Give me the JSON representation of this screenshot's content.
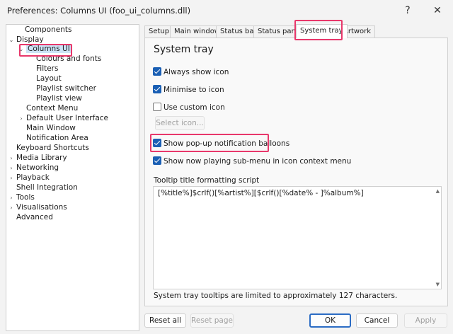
{
  "window": {
    "title": "Preferences: Columns UI (foo_ui_columns.dll)",
    "help_label": "?",
    "close_label": "✕"
  },
  "tree": {
    "items": [
      {
        "label": "Components",
        "expander": ""
      },
      {
        "label": "Display",
        "expander": "⌄"
      },
      {
        "label": "Columns UI",
        "expander": "⌄"
      },
      {
        "label": "Colours and fonts",
        "expander": ""
      },
      {
        "label": "Filters",
        "expander": ""
      },
      {
        "label": "Layout",
        "expander": ""
      },
      {
        "label": "Playlist switcher",
        "expander": ""
      },
      {
        "label": "Playlist view",
        "expander": ""
      },
      {
        "label": "Context Menu",
        "expander": ""
      },
      {
        "label": "Default User Interface",
        "expander": "›"
      },
      {
        "label": "Main Window",
        "expander": ""
      },
      {
        "label": "Notification Area",
        "expander": ""
      },
      {
        "label": "Keyboard Shortcuts",
        "expander": ""
      },
      {
        "label": "Media Library",
        "expander": "›"
      },
      {
        "label": "Networking",
        "expander": "›"
      },
      {
        "label": "Playback",
        "expander": "›"
      },
      {
        "label": "Shell Integration",
        "expander": ""
      },
      {
        "label": "Tools",
        "expander": "›"
      },
      {
        "label": "Visualisations",
        "expander": "›"
      },
      {
        "label": "Advanced",
        "expander": ""
      }
    ]
  },
  "tabs": [
    "Setup",
    "Main window",
    "Status bar",
    "Status pane",
    "System tray",
    "Artwork"
  ],
  "panel": {
    "title": "System tray",
    "always_show_icon": "Always show icon",
    "minimise_to_icon": "Minimise to icon",
    "use_custom_icon": "Use custom icon",
    "select_icon": "Select icon...",
    "show_balloons": "Show pop-up notification balloons",
    "show_now_playing": "Show now playing sub-menu in icon context menu",
    "script_label": "Tooltip title formatting script",
    "script_value": "[%title%]$crlf()[%artist%][$crlf()[%date% - ]%album%]",
    "note": "System tray tooltips are limited to approximately 127 characters."
  },
  "buttons": {
    "reset_all": "Reset all",
    "reset_page": "Reset page",
    "ok": "OK",
    "cancel": "Cancel",
    "apply": "Apply"
  },
  "colors": {
    "highlight_box": "#e8386b",
    "checkbox_accent": "#1a5fb4",
    "selection": "#cde4f7"
  }
}
